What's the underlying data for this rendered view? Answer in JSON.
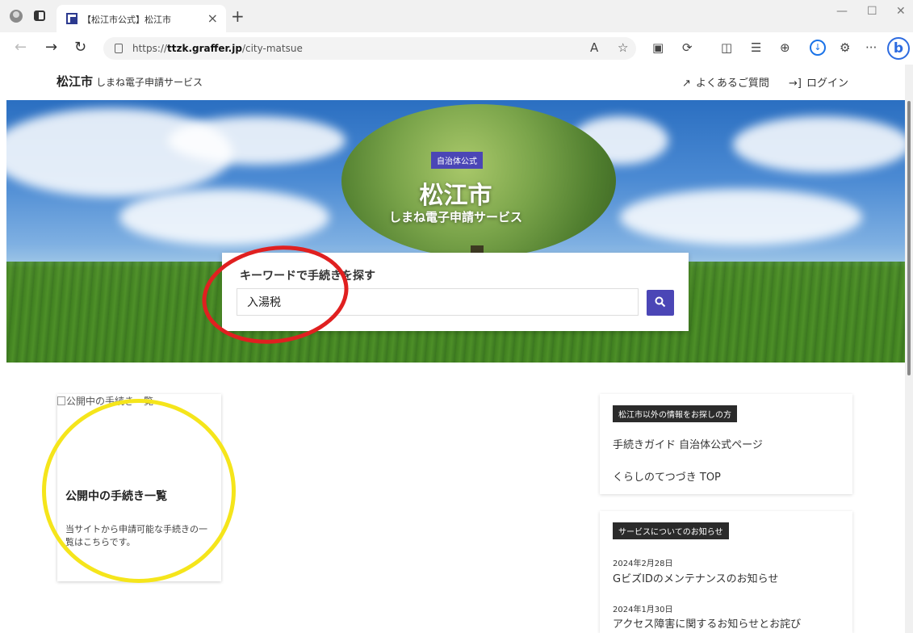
{
  "browser": {
    "tab_title": "【松江市公式】松江市",
    "url_prefix": "https://",
    "url_domain": "ttzk.graffer.jp",
    "url_path": "/city-matsue",
    "icons": [
      "profile-icon",
      "tabs-icon",
      "back-icon",
      "forward-icon",
      "reload-icon",
      "lock-icon",
      "read-aloud-icon",
      "favorite-icon",
      "collections-icon",
      "split-screen-icon",
      "favorites-list-icon",
      "extensions-icon",
      "download-icon",
      "more-icon",
      "bing-icon"
    ]
  },
  "header": {
    "brand_city": "松江市",
    "brand_sub": "しまね電子申請サービス",
    "faq": "よくあるご質問",
    "login": "ログイン"
  },
  "hero": {
    "badge": "自治体公式",
    "title": "松江市",
    "subtitle": "しまね電子申請サービス"
  },
  "search": {
    "heading": "キーワードで手続きを探す",
    "value": "入湯税"
  },
  "procedures_card": {
    "image_alt": "公開中の手続き一覧",
    "title": "公開中の手続き一覧",
    "description": "当サイトから申請可能な手続きの一覧はこちらです。"
  },
  "other_info": {
    "tag": "松江市以外の情報をお探しの方",
    "links": [
      "手続きガイド 自治体公式ページ",
      "くらしのてつづき TOP"
    ]
  },
  "news": {
    "tag": "サービスについてのお知らせ",
    "items": [
      {
        "date": "2024年2月28日",
        "title": "GビズIDのメンテナンスのお知らせ"
      },
      {
        "date": "2024年1月30日",
        "title": "アクセス障害に関するお知らせとお詫び"
      }
    ]
  },
  "colors": {
    "accent": "#4b46b6",
    "tag_dark": "#2b2b2b",
    "annotation_red": "#e02020",
    "annotation_yellow": "#f5e51b"
  }
}
